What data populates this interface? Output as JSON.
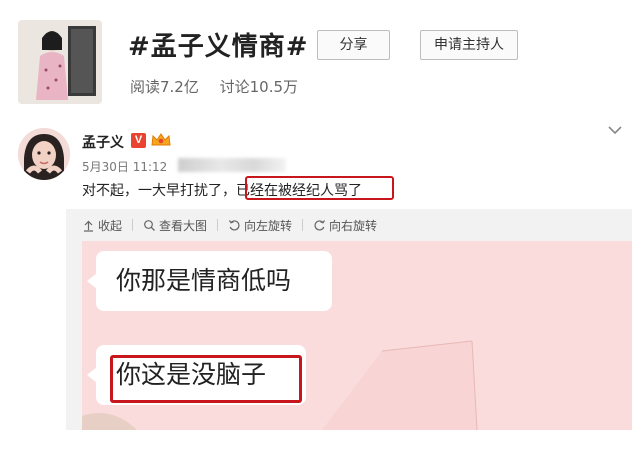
{
  "topic": {
    "title": "#孟子义情商#",
    "share_label": "分享",
    "apply_host_label": "申请主持人",
    "reads": "阅读7.2亿",
    "discussions": "讨论10.5万"
  },
  "post": {
    "username": "孟子义",
    "verified_badge": "V",
    "timestamp": "5月30日 11:12",
    "text_before": "对不起，一大早打扰了，",
    "text_highlighted": "已经在被经纪人骂了",
    "more_icon": "chevron-down-icon"
  },
  "image_toolbar": {
    "collapse": "收起",
    "view_large": "查看大图",
    "rotate_left": "向左旋转",
    "rotate_right": "向右旋转"
  },
  "chat_image": {
    "message1": "你那是情商低吗",
    "message2": "你这是没脑子"
  },
  "colors": {
    "highlight_red": "#c8161d",
    "chat_background": "#fadcdc",
    "badge_red": "#e8442f"
  }
}
